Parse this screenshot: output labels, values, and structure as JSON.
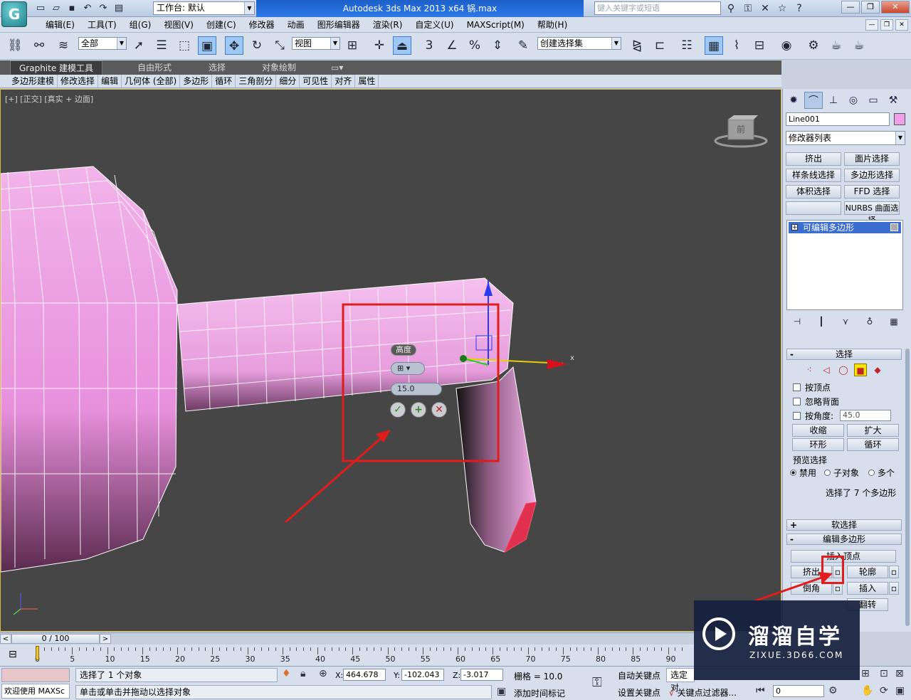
{
  "titlebar": {
    "workspace_label": "工作台: 默认",
    "title": "Autodesk 3ds Max  2013 x64      锅.max",
    "search_placeholder": "键入关键字或短语"
  },
  "menu": [
    "编辑(E)",
    "工具(T)",
    "组(G)",
    "视图(V)",
    "创建(C)",
    "修改器",
    "动画",
    "图形编辑器",
    "渲染(R)",
    "自定义(U)",
    "MAXScript(M)",
    "帮助(H)"
  ],
  "toolbar": {
    "filter_value": "全部",
    "ref_coord_value": "视图",
    "snap_3": "3",
    "selection_set_placeholder": "创建选择集"
  },
  "ribbon": {
    "tabs": [
      "Graphite 建模工具",
      "自由形式",
      "选择",
      "对象绘制"
    ],
    "panels": [
      "多边形建模",
      "修改选择",
      "编辑",
      "几何体 (全部)",
      "多边形",
      "循环",
      "三角剖分",
      "细分",
      "可见性",
      "对齐",
      "属性"
    ]
  },
  "viewport": {
    "label": "[+] [正交] [真实 + 边面]",
    "viewcube_face": "前",
    "gizmo_x_label": "x",
    "caddy": {
      "title": "高度",
      "value": "15.0"
    }
  },
  "command_panel": {
    "object_name": "Line001",
    "object_color": "#f0a0e6",
    "modifier_list": "修改器列表",
    "modifier_buttons": [
      "挤出",
      "面片选择",
      "样条线选择",
      "多边形选择",
      "体积选择",
      "FFD 选择",
      "",
      "NURBS 曲面选择"
    ],
    "stack_item": "可编辑多边形",
    "selection_rollout": {
      "title": "选择",
      "by_vertex": "按顶点",
      "ignore_backfacing": "忽略背面",
      "by_angle": "按角度:",
      "angle_value": "45.0",
      "shrink": "收缩",
      "grow": "扩大",
      "ring": "环形",
      "loop": "循环",
      "preview_label": "预览选择",
      "preview_disabled": "禁用",
      "preview_subobject": "子对象",
      "preview_multi": "多个",
      "status": "选择了 7 个多边形"
    },
    "soft_selection_title": "软选择",
    "edit_poly_title": "编辑多边形",
    "edit_poly_buttons": [
      "插入顶点",
      "挤出",
      "轮廓",
      "倒角",
      "插入",
      "翻转"
    ]
  },
  "timeline": {
    "frame_display": "0 / 100",
    "ticks": [
      "0",
      "5",
      "10",
      "15",
      "20",
      "25",
      "30",
      "35",
      "40",
      "45",
      "50",
      "55",
      "60",
      "65",
      "70",
      "75",
      "80",
      "85",
      "90"
    ]
  },
  "status": {
    "maxscript_text": "欢迎使用 MAXSc",
    "selected_text": "选择了 1 个对象",
    "prompt_text": "单击或单击并拖动以选择对象",
    "x_value": "464.678",
    "y_value": "-102.043",
    "z_value": "-3.017",
    "grid_text": "栅格 = 10.0",
    "add_time_tag": "添加时间标记",
    "auto_key": "自动关键点",
    "set_key": "设置关键点",
    "selected_object": "选定对",
    "key_filters": "关键点过滤器...",
    "frame_value": "0"
  },
  "watermark": {
    "brand": "溜溜自学",
    "url": "ZIXUE.3D66.COM"
  },
  "colors": {
    "object_pink": "#f0a0e6",
    "annotation_red": "#e01c1c",
    "viewport_bg": "#464646"
  }
}
